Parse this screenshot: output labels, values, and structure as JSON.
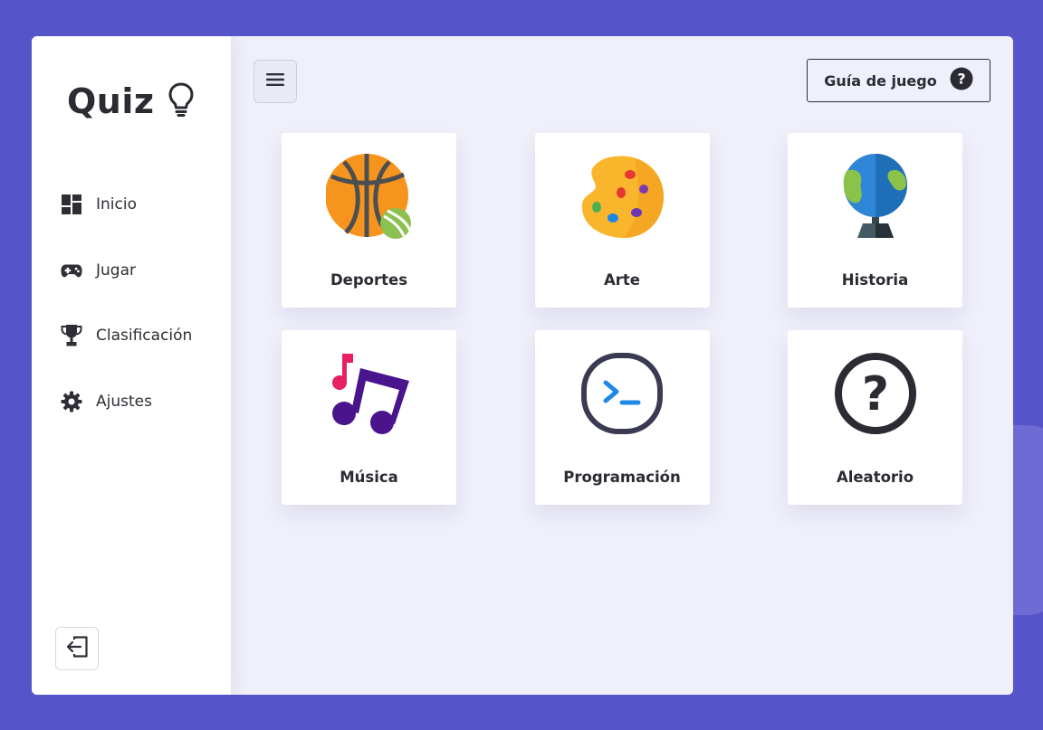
{
  "app": {
    "logo_text": "Quiz",
    "logo_icon": "lightbulb-icon"
  },
  "sidebar": {
    "items": [
      {
        "label": "Inicio",
        "icon": "dashboard-icon"
      },
      {
        "label": "Jugar",
        "icon": "gamepad-icon"
      },
      {
        "label": "Clasificación",
        "icon": "trophy-icon"
      },
      {
        "label": "Ajustes",
        "icon": "gear-icon"
      }
    ],
    "logout_icon": "logout-icon"
  },
  "header": {
    "menu_icon": "hamburger-menu-icon",
    "guide_label": "Guía de juego",
    "guide_icon": "help-circle-icon"
  },
  "categories": [
    {
      "label": "Deportes",
      "icon": "sports-balls-icon"
    },
    {
      "label": "Arte",
      "icon": "paint-palette-icon"
    },
    {
      "label": "Historia",
      "icon": "globe-icon"
    },
    {
      "label": "Música",
      "icon": "music-notes-icon"
    },
    {
      "label": "Programación",
      "icon": "terminal-icon"
    },
    {
      "label": "Aleatorio",
      "icon": "question-circle-icon"
    }
  ],
  "colors": {
    "background": "#5654c9",
    "panel": "#f0f0fb",
    "text": "#2b2b33"
  }
}
